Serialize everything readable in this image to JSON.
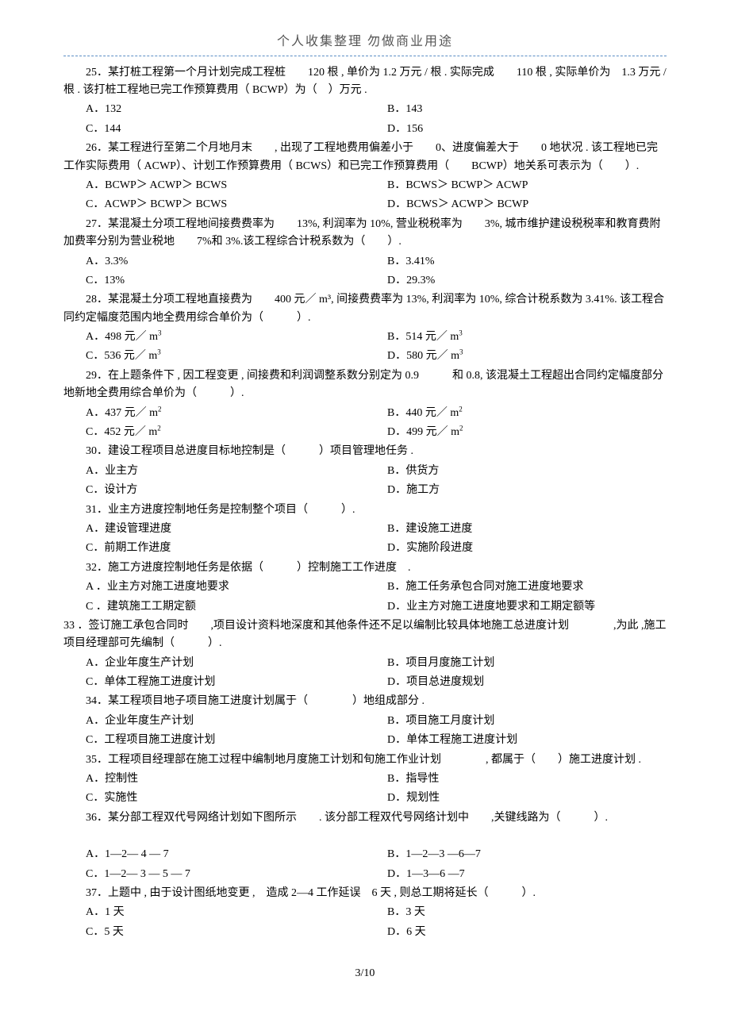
{
  "header": "个人收集整理    勿做商业用途",
  "q25": {
    "text": "25．某打桩工程第一个月计划完成工程桩　　120 根 , 单价为 1.2 万元 / 根 . 实际完成　　110 根 , 实际单价为　1.3 万元 / 根 . 该打桩工程地已完工作预算费用（ BCWP）为（　）万元 .",
    "A": "A．132",
    "B": "B．143",
    "C": "C．144",
    "D": "D．156"
  },
  "q26": {
    "text": "26．某工程进行至第二个月地月末　　, 出现了工程地费用偏差小于　　0、进度偏差大于　　0 地状况 . 该工程地已完工作实际费用（ ACWP）、计划工作预算费用（ BCWS）和已完工作预算费用（　　BCWP）地关系可表示为（　　）.",
    "A": "A．BCWP＞ ACWP＞ BCWS",
    "B": "B．BCWS＞ BCWP＞ ACWP",
    "C": "C．ACWP＞ BCWP＞ BCWS",
    "D": "D．BCWS＞ ACWP＞ BCWP"
  },
  "q27": {
    "text": "27．某混凝土分项工程地间接费费率为　　13%, 利润率为 10%, 营业税税率为　　3%, 城市维护建设税税率和教育费附加费率分别为营业税地　　7%和 3%.该工程综合计税系数为（　　）.",
    "A": "A．3.3%",
    "B": "B．3.41%",
    "C": "C．13%",
    "D": "D．29.3%"
  },
  "q28": {
    "text": "28．某混凝土分项工程地直接费为　　400 元／ m³, 间接费费率为 13%, 利润率为 10%, 综合计税系数为 3.41%. 该工程合同约定幅度范围内地全费用综合单价为（　　　）.",
    "A": "A．498 元／ m",
    "B": "B．514 元／ m",
    "C": "C．536 元／ m",
    "D": "D．580 元／ m",
    "sup": "3"
  },
  "q29": {
    "text": "29．在上题条件下 , 因工程变更 , 间接费和利润调整系数分别定为 0.9　　　和 0.8, 该混凝土工程超出合同约定幅度部分地新地全费用综合单价为（　　　）.",
    "A": "A．437 元／ m",
    "B": "B．440 元／ m",
    "C": "C．452 元／ m",
    "D": "D．499 元／ m",
    "sup": "2"
  },
  "q30": {
    "text": "30．建设工程项目总进度目标地控制是（　　　）项目管理地任务  .",
    "A": "A．业主方",
    "B": "B．供货方",
    "C": "C．设计方",
    "D": "D．施工方"
  },
  "q31": {
    "text": "31．业主方进度控制地任务是控制整个项目（　　　）.",
    "A": "A．建设管理进度",
    "B": "B．建设施工进度",
    "C": "C．前期工作进度",
    "D": "D．实施阶段进度"
  },
  "q32": {
    "text": "32．施工方进度控制地任务是依据（　　　）控制施工工作进度　.",
    "A": "A ．业主方对施工进度地要求",
    "B": "B．施工任务承包合同对施工进度地要求",
    "C": "C ．建筑施工工期定额",
    "D": "D．业主方对施工进度地要求和工期定额等"
  },
  "q33": {
    "text": "33 ．签订施工承包合同时　　,项目设计资料地深度和其他条件还不足以编制比较具体地施工总进度计划　　　　,为此 ,施工项目经理部可先编制（　　　）.",
    "A": "A．企业年度生产计划",
    "B": "B．项目月度施工计划",
    "C": "C．单体工程施工进度计划",
    "D": "D．项目总进度规划"
  },
  "q34": {
    "text": "34．某工程项目地子项目施工进度计划属于（　　　　）地组成部分  .",
    "A": "A．企业年度生产计划",
    "B": "B．项目施工月度计划",
    "C": "C．工程项目施工进度计划",
    "D": "D．单体工程施工进度计划"
  },
  "q35": {
    "text": "35．工程项目经理部在施工过程中编制地月度施工计划和旬施工作业计划　　　　, 都属于（　　）施工进度计划  .",
    "A": "A．控制性",
    "B": "B．指导性",
    "C": "C．实施性",
    "D": "D．规划性"
  },
  "q36": {
    "text": "36．某分部工程双代号网络计划如下图所示　　. 该分部工程双代号网络计划中　　,关键线路为（　　　）.",
    "A": "A．1—2— 4 — 7",
    "B": "B．1—2—3 —6—7",
    "C": "C．1—2— 3 — 5 — 7",
    "D": "D．1—3—6 —7"
  },
  "q37": {
    "text": "37．上题中 , 由于设计图纸地变更  ,　造成 2—4 工作延误　6 天 , 则总工期将延长（　　　）.",
    "A": "A．1 天",
    "B": "B．3 天",
    "C": "C．5 天",
    "D": "D．6 天"
  },
  "page_num": "3/10"
}
